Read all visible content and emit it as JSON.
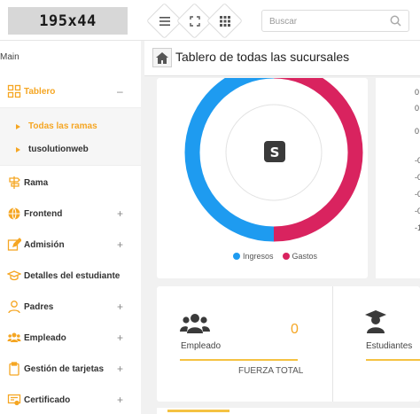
{
  "header": {
    "logo_text": "195x44",
    "search_placeholder": "Buscar"
  },
  "sidebar": {
    "main_label": "Main",
    "items": [
      {
        "label": "Tablero",
        "icon": "grid-icon",
        "expanded": true
      },
      {
        "label": "Rama",
        "icon": "signpost-icon"
      },
      {
        "label": "Frontend",
        "icon": "globe-icon",
        "plus": "+"
      },
      {
        "label": "Admisión",
        "icon": "edit-icon",
        "plus": "+"
      },
      {
        "label": "Detalles del estudiante",
        "icon": "graduation-cap-icon",
        "plus": "+"
      },
      {
        "label": "Padres",
        "icon": "user-icon",
        "plus": "+"
      },
      {
        "label": "Empleado",
        "icon": "users-icon",
        "plus": "+"
      },
      {
        "label": "Gestión de tarjetas",
        "icon": "clipboard-icon",
        "plus": "+"
      },
      {
        "label": "Certificado",
        "icon": "certificate-icon",
        "plus": "+"
      }
    ],
    "collapse_symbol": "–",
    "submenu": [
      {
        "label": "Todas las ramas",
        "active": true
      },
      {
        "label": "tusolutionweb",
        "active": false
      }
    ]
  },
  "titlebar": {
    "title": "Tablero de todas las sucursales"
  },
  "donut": {
    "legend": [
      {
        "name": "Ingresos",
        "color": "#1e9bf0"
      },
      {
        "name": "Gastos",
        "color": "#d9235f"
      }
    ],
    "shares": {
      "Ingresos": 0.5,
      "Gastos": 0.5
    }
  },
  "right_panel": {
    "labels": [
      "0",
      "0",
      "0",
      "-0",
      "-0",
      "-0",
      "-0",
      "-1"
    ]
  },
  "stats": {
    "empleado_label": "Empleado",
    "empleado_value": "0",
    "fuerza_label": "FUERZA TOTAL",
    "estudiantes_label": "Estudiantes"
  },
  "colors": {
    "accent": "#f5a623",
    "income": "#1e9bf0",
    "expense": "#d9235f"
  }
}
